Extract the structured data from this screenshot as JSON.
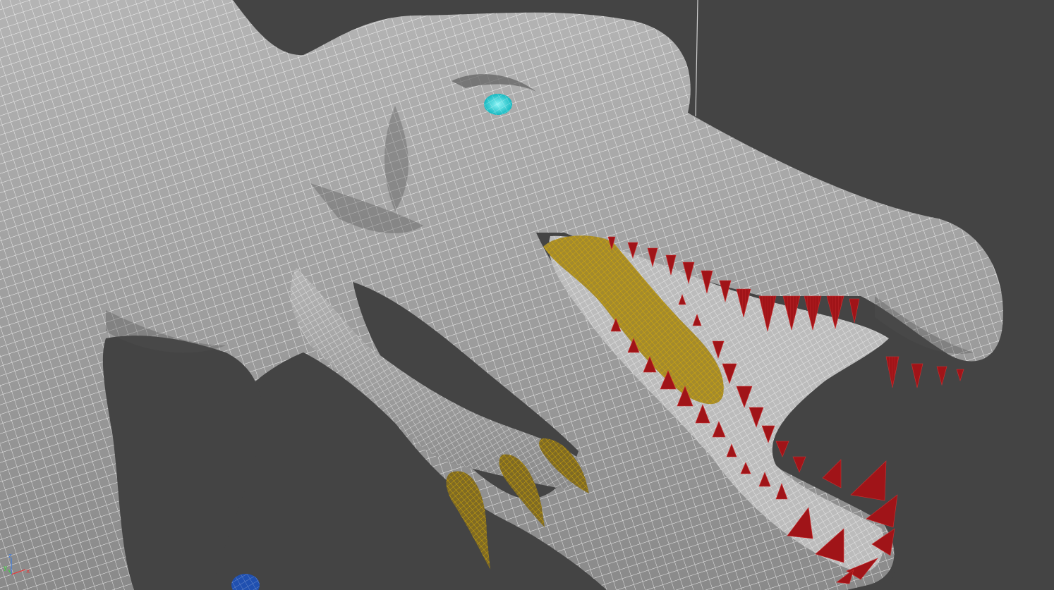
{
  "viewport": {
    "background": "#444444",
    "mesh_shade": "#a9a9a9",
    "mesh_shadow": "#6e6e6e",
    "wire_color": "#ffffff",
    "selection_color": "#e0b400",
    "teeth_color": "#a01418",
    "eye_color": "#22d6dc",
    "blue_object_color": "#2050b0",
    "construction_line_color": "#cfcfcf"
  },
  "model": {
    "name": "spinosaurus-wireframe-mesh",
    "selected_parts": [
      "tongue",
      "claws"
    ]
  },
  "axis_gizmo": {
    "x_label": "x",
    "y_label": "y",
    "z_label": "z",
    "x_color": "#e03a3a",
    "y_color": "#3ad43a",
    "z_color": "#3a7ae0"
  }
}
